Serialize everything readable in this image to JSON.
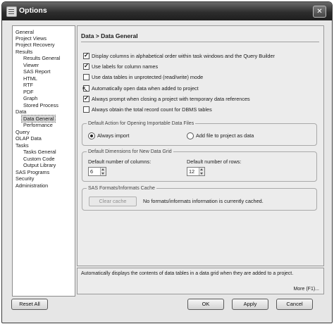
{
  "window": {
    "title": "Options",
    "close": "✕"
  },
  "sidebar": {
    "items": [
      {
        "label": "General",
        "indent": 0
      },
      {
        "label": "Project Views",
        "indent": 0
      },
      {
        "label": "Project Recovery",
        "indent": 0
      },
      {
        "label": "Results",
        "indent": 0
      },
      {
        "label": "Results General",
        "indent": 1
      },
      {
        "label": "Viewer",
        "indent": 1
      },
      {
        "label": "SAS Report",
        "indent": 1
      },
      {
        "label": "HTML",
        "indent": 1
      },
      {
        "label": "RTF",
        "indent": 1
      },
      {
        "label": "PDF",
        "indent": 1
      },
      {
        "label": "Graph",
        "indent": 1
      },
      {
        "label": "Stored Process",
        "indent": 1
      },
      {
        "label": "Data",
        "indent": 0
      },
      {
        "label": "Data General",
        "indent": 1,
        "selected": true
      },
      {
        "label": "Performance",
        "indent": 1
      },
      {
        "label": "Query",
        "indent": 0
      },
      {
        "label": "OLAP Data",
        "indent": 0
      },
      {
        "label": "Tasks",
        "indent": 0
      },
      {
        "label": "Tasks General",
        "indent": 1
      },
      {
        "label": "Custom Code",
        "indent": 1
      },
      {
        "label": "Output Library",
        "indent": 1
      },
      {
        "label": "SAS Programs",
        "indent": 0
      },
      {
        "label": "Security",
        "indent": 0
      },
      {
        "label": "Administration",
        "indent": 0
      }
    ]
  },
  "content": {
    "heading": "Data > Data General",
    "checkboxes": [
      {
        "label": "Display columns in alphabetical order within task windows and the Query Builder",
        "checked": true
      },
      {
        "label": "Use labels for column names",
        "checked": true
      },
      {
        "label": "Use data tables in unprotected (read/write) mode",
        "checked": false
      },
      {
        "label": "Automatically open data when added to project",
        "checked": false
      },
      {
        "label": "Always prompt when closing a project with temporary data references",
        "checked": true
      },
      {
        "label": "Always obtain the total record count for DBMS tables",
        "checked": false
      }
    ],
    "default_action": {
      "legend": "Default Action for Opening Importable Data Files",
      "options": [
        {
          "label": "Always import",
          "selected": true
        },
        {
          "label": "Add file to project as data",
          "selected": false
        }
      ]
    },
    "grid_dims": {
      "legend": "Default Dimensions for New Data Grid",
      "columns_label": "Default number of columns:",
      "columns_value": "6",
      "rows_label": "Default number of rows:",
      "rows_value": "12"
    },
    "formats_cache": {
      "legend": "SAS Formats/Informats Cache",
      "clear_label": "Clear cache",
      "status": "No formats/informats information is currently cached."
    }
  },
  "description": {
    "text": "Automatically displays the contents of data tables in a data grid when they are added to a project.",
    "more": "More (F1)..."
  },
  "buttons": {
    "reset": "Reset All",
    "ok": "OK",
    "apply": "Apply",
    "cancel": "Cancel"
  }
}
